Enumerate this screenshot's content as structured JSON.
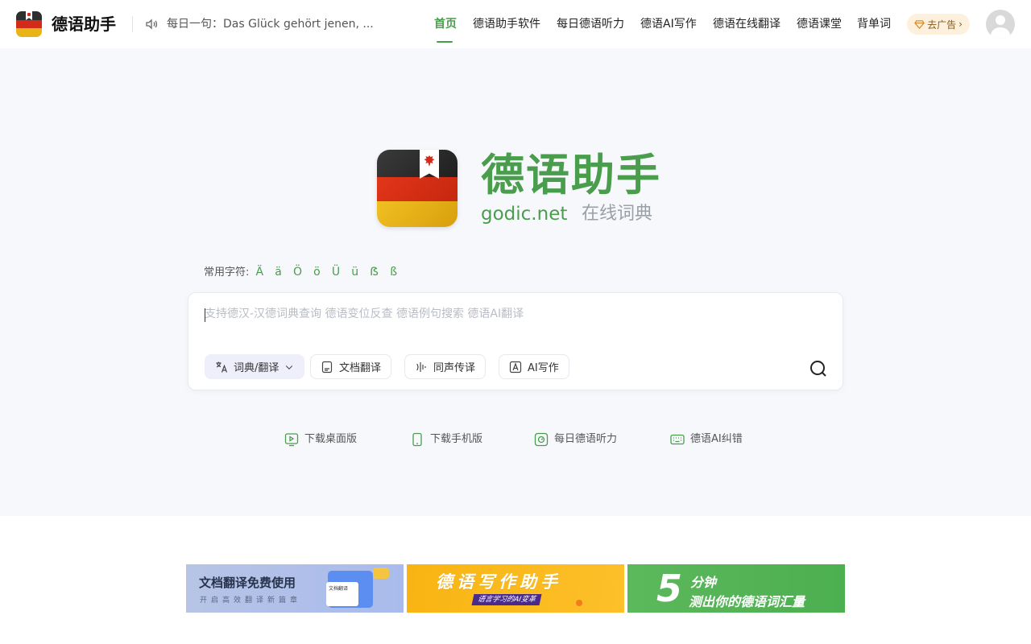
{
  "header": {
    "brand": "德语助手",
    "daily_sentence": "每日一句：Das Glück gehört jenen, ...",
    "nav": [
      {
        "label": "首页",
        "active": true
      },
      {
        "label": "德语助手软件"
      },
      {
        "label": "每日德语听力"
      },
      {
        "label": "德语AI写作"
      },
      {
        "label": "德语在线翻译"
      },
      {
        "label": "德语课堂"
      },
      {
        "label": "背单词"
      }
    ],
    "ad_button": "去广告",
    "ad_chevron": "›"
  },
  "hero": {
    "title": "德语助手",
    "domain": "godic.net",
    "subtitle": "在线词典",
    "chars_label": "常用字符:",
    "chars": [
      "Ä",
      "ä",
      "Ö",
      "ö",
      "Ü",
      "ü",
      "ẞ",
      "ß"
    ]
  },
  "search": {
    "placeholder": "支持德汉-汉德词典查询 德语变位反查 德语例句搜索 德语AI翻译",
    "tools": [
      {
        "label": "词典/翻译",
        "icon": "translate-icon",
        "selected": true
      },
      {
        "label": "文档翻译",
        "icon": "document-icon"
      },
      {
        "label": "同声传译",
        "icon": "voice-wave-icon"
      },
      {
        "label": "AI写作",
        "icon": "ai-write-icon"
      }
    ]
  },
  "quick_links": [
    {
      "label": "下载桌面版",
      "icon": "desktop-play-icon"
    },
    {
      "label": "下载手机版",
      "icon": "phone-icon"
    },
    {
      "label": "每日德语听力",
      "icon": "audio-icon"
    },
    {
      "label": "德语AI纠错",
      "icon": "keyboard-icon"
    }
  ],
  "banners": {
    "doc": {
      "title": "文档翻译免费使用",
      "subtitle": "开启高效翻译新篇章",
      "card": "文档翻译"
    },
    "writing": {
      "title": "德语写作助手",
      "subtitle": "语言学习的AI变革"
    },
    "vocab": {
      "number": "5",
      "line1": "分钟",
      "line2": "测出你的德语词汇量"
    }
  },
  "colors": {
    "accent": "#4a9d4c",
    "hero_bg": "#f7f8fc"
  }
}
